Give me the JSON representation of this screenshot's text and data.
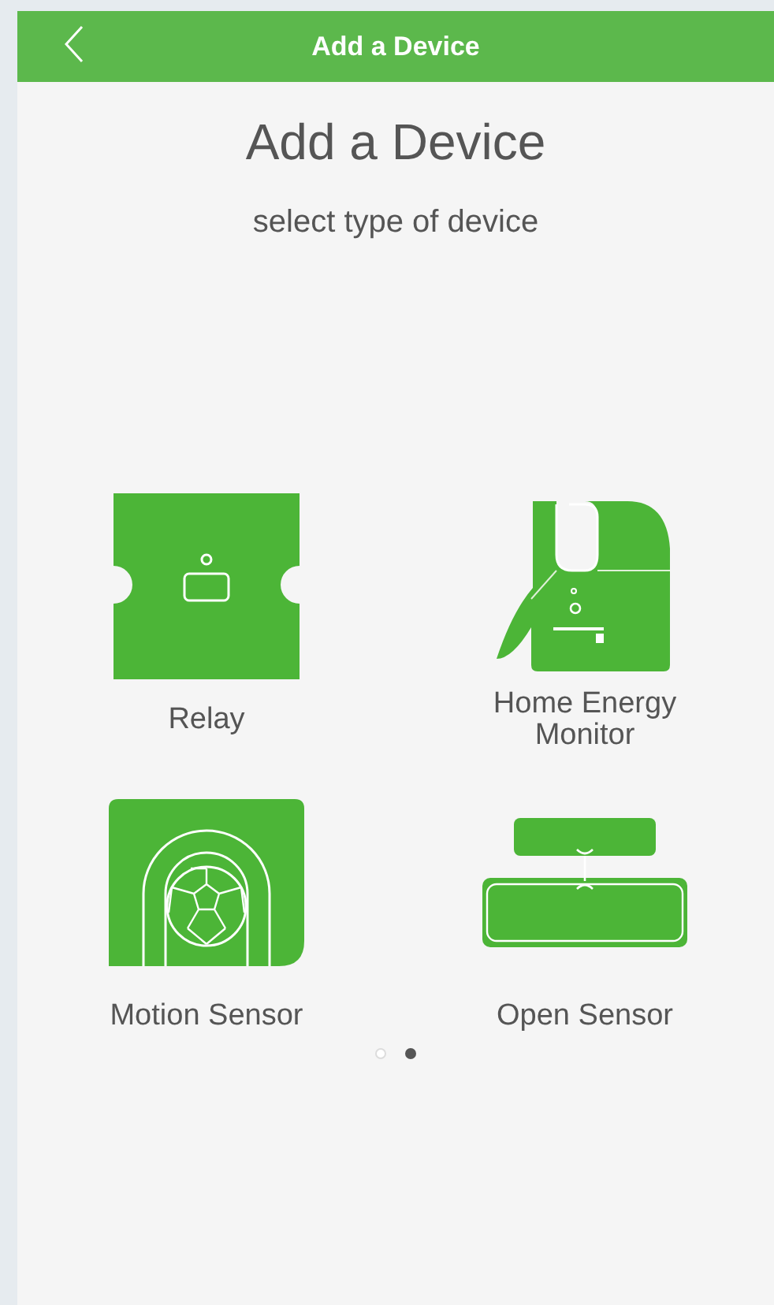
{
  "header": {
    "title": "Add a Device"
  },
  "heading": "Add a Device",
  "subheading": "select type of device",
  "devices": [
    {
      "label": "Relay",
      "kind": "relay"
    },
    {
      "label": "Home Energy Monitor",
      "kind": "energy_monitor"
    },
    {
      "label": "Motion Sensor",
      "kind": "motion_sensor"
    },
    {
      "label": "Open Sensor",
      "kind": "open_sensor"
    }
  ],
  "page_dots": [
    {
      "selected": false
    },
    {
      "selected": true
    }
  ]
}
